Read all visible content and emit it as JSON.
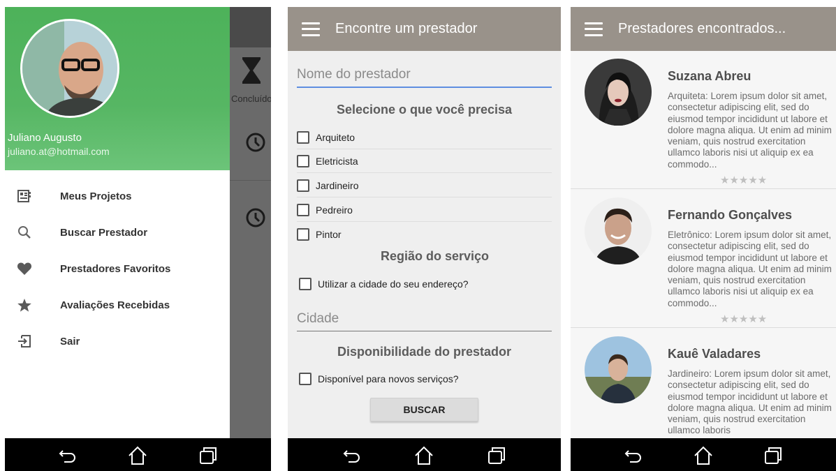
{
  "screen1": {
    "behind": {
      "status_label": "Concluído"
    },
    "drawer": {
      "user_name": "Juliano Augusto",
      "user_email": "juliano.at@hotmail.com",
      "menu": [
        {
          "label": "Meus Projetos",
          "icon": "projects-icon"
        },
        {
          "label": "Buscar Prestador",
          "icon": "search-icon"
        },
        {
          "label": "Prestadores Favoritos",
          "icon": "heart-icon"
        },
        {
          "label": "Avaliações Recebidas",
          "icon": "star-icon"
        },
        {
          "label": "Sair",
          "icon": "exit-icon"
        }
      ]
    }
  },
  "screen2": {
    "title": "Encontre um prestador",
    "name_placeholder": "Nome do prestador",
    "section_need": "Selecione o que você precisa",
    "options": [
      "Arquiteto",
      "Eletricista",
      "Jardineiro",
      "Pedreiro",
      "Pintor"
    ],
    "section_region": "Região do serviço",
    "use_city_label": "Utilizar a cidade do seu endereço?",
    "city_placeholder": "Cidade",
    "section_availability": "Disponibilidade do prestador",
    "available_label": "Disponível para novos serviços?",
    "search_button": "BUSCAR"
  },
  "screen3": {
    "title": "Prestadores encontrados...",
    "results": [
      {
        "name": "Suzana Abreu",
        "description": "Arquiteta: Lorem ipsum dolor sit amet, consectetur adipiscing elit, sed do eiusmod tempor incididunt ut labore et dolore magna aliqua. Ut enim ad minim veniam, quis nostrud exercitation ullamco laboris nisi ut aliquip ex ea commodo...",
        "stars": "★★★★★"
      },
      {
        "name": "Fernando Gonçalves",
        "description": "Eletrônico: Lorem ipsum dolor sit amet, consectetur adipiscing elit, sed do eiusmod tempor incididunt ut labore et dolore magna aliqua. Ut enim ad minim veniam, quis nostrud exercitation ullamco laboris nisi ut aliquip ex ea commodo...",
        "stars": "★★★★★"
      },
      {
        "name": "Kauê Valadares",
        "description": "Jardineiro: Lorem ipsum dolor sit amet, consectetur adipiscing elit, sed do eiusmod tempor incididunt ut labore et dolore magna aliqua. Ut enim ad minim veniam, quis nostrud exercitation ullamco laboris",
        "stars": ""
      }
    ]
  },
  "colors": {
    "appbar": "#99928a",
    "drawer_header": "#4db25a",
    "field_focus": "#5e8ee0",
    "navbar": "#000000"
  }
}
